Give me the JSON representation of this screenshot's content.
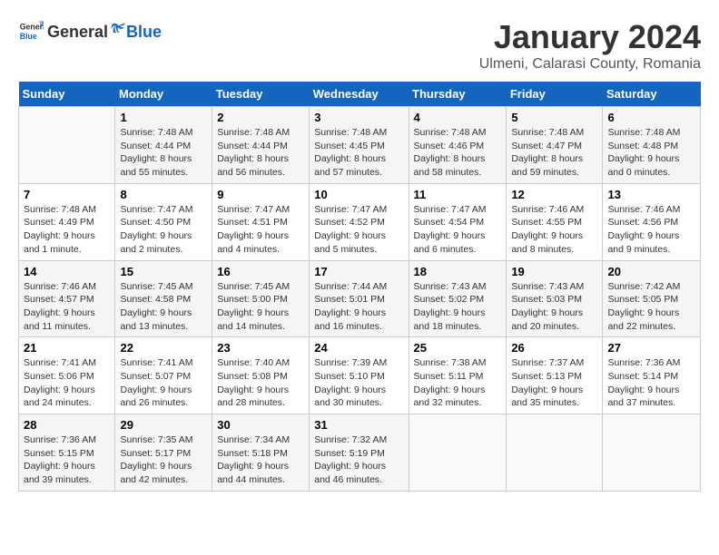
{
  "header": {
    "logo_general": "General",
    "logo_blue": "Blue",
    "title": "January 2024",
    "subtitle": "Ulmeni, Calarasi County, Romania"
  },
  "days_of_week": [
    "Sunday",
    "Monday",
    "Tuesday",
    "Wednesday",
    "Thursday",
    "Friday",
    "Saturday"
  ],
  "weeks": [
    [
      {
        "day": "",
        "info": ""
      },
      {
        "day": "1",
        "info": "Sunrise: 7:48 AM\nSunset: 4:44 PM\nDaylight: 8 hours\nand 55 minutes."
      },
      {
        "day": "2",
        "info": "Sunrise: 7:48 AM\nSunset: 4:44 PM\nDaylight: 8 hours\nand 56 minutes."
      },
      {
        "day": "3",
        "info": "Sunrise: 7:48 AM\nSunset: 4:45 PM\nDaylight: 8 hours\nand 57 minutes."
      },
      {
        "day": "4",
        "info": "Sunrise: 7:48 AM\nSunset: 4:46 PM\nDaylight: 8 hours\nand 58 minutes."
      },
      {
        "day": "5",
        "info": "Sunrise: 7:48 AM\nSunset: 4:47 PM\nDaylight: 8 hours\nand 59 minutes."
      },
      {
        "day": "6",
        "info": "Sunrise: 7:48 AM\nSunset: 4:48 PM\nDaylight: 9 hours\nand 0 minutes."
      }
    ],
    [
      {
        "day": "7",
        "info": "Sunrise: 7:48 AM\nSunset: 4:49 PM\nDaylight: 9 hours\nand 1 minute."
      },
      {
        "day": "8",
        "info": "Sunrise: 7:47 AM\nSunset: 4:50 PM\nDaylight: 9 hours\nand 2 minutes."
      },
      {
        "day": "9",
        "info": "Sunrise: 7:47 AM\nSunset: 4:51 PM\nDaylight: 9 hours\nand 4 minutes."
      },
      {
        "day": "10",
        "info": "Sunrise: 7:47 AM\nSunset: 4:52 PM\nDaylight: 9 hours\nand 5 minutes."
      },
      {
        "day": "11",
        "info": "Sunrise: 7:47 AM\nSunset: 4:54 PM\nDaylight: 9 hours\nand 6 minutes."
      },
      {
        "day": "12",
        "info": "Sunrise: 7:46 AM\nSunset: 4:55 PM\nDaylight: 9 hours\nand 8 minutes."
      },
      {
        "day": "13",
        "info": "Sunrise: 7:46 AM\nSunset: 4:56 PM\nDaylight: 9 hours\nand 9 minutes."
      }
    ],
    [
      {
        "day": "14",
        "info": "Sunrise: 7:46 AM\nSunset: 4:57 PM\nDaylight: 9 hours\nand 11 minutes."
      },
      {
        "day": "15",
        "info": "Sunrise: 7:45 AM\nSunset: 4:58 PM\nDaylight: 9 hours\nand 13 minutes."
      },
      {
        "day": "16",
        "info": "Sunrise: 7:45 AM\nSunset: 5:00 PM\nDaylight: 9 hours\nand 14 minutes."
      },
      {
        "day": "17",
        "info": "Sunrise: 7:44 AM\nSunset: 5:01 PM\nDaylight: 9 hours\nand 16 minutes."
      },
      {
        "day": "18",
        "info": "Sunrise: 7:43 AM\nSunset: 5:02 PM\nDaylight: 9 hours\nand 18 minutes."
      },
      {
        "day": "19",
        "info": "Sunrise: 7:43 AM\nSunset: 5:03 PM\nDaylight: 9 hours\nand 20 minutes."
      },
      {
        "day": "20",
        "info": "Sunrise: 7:42 AM\nSunset: 5:05 PM\nDaylight: 9 hours\nand 22 minutes."
      }
    ],
    [
      {
        "day": "21",
        "info": "Sunrise: 7:41 AM\nSunset: 5:06 PM\nDaylight: 9 hours\nand 24 minutes."
      },
      {
        "day": "22",
        "info": "Sunrise: 7:41 AM\nSunset: 5:07 PM\nDaylight: 9 hours\nand 26 minutes."
      },
      {
        "day": "23",
        "info": "Sunrise: 7:40 AM\nSunset: 5:08 PM\nDaylight: 9 hours\nand 28 minutes."
      },
      {
        "day": "24",
        "info": "Sunrise: 7:39 AM\nSunset: 5:10 PM\nDaylight: 9 hours\nand 30 minutes."
      },
      {
        "day": "25",
        "info": "Sunrise: 7:38 AM\nSunset: 5:11 PM\nDaylight: 9 hours\nand 32 minutes."
      },
      {
        "day": "26",
        "info": "Sunrise: 7:37 AM\nSunset: 5:13 PM\nDaylight: 9 hours\nand 35 minutes."
      },
      {
        "day": "27",
        "info": "Sunrise: 7:36 AM\nSunset: 5:14 PM\nDaylight: 9 hours\nand 37 minutes."
      }
    ],
    [
      {
        "day": "28",
        "info": "Sunrise: 7:36 AM\nSunset: 5:15 PM\nDaylight: 9 hours\nand 39 minutes."
      },
      {
        "day": "29",
        "info": "Sunrise: 7:35 AM\nSunset: 5:17 PM\nDaylight: 9 hours\nand 42 minutes."
      },
      {
        "day": "30",
        "info": "Sunrise: 7:34 AM\nSunset: 5:18 PM\nDaylight: 9 hours\nand 44 minutes."
      },
      {
        "day": "31",
        "info": "Sunrise: 7:32 AM\nSunset: 5:19 PM\nDaylight: 9 hours\nand 46 minutes."
      },
      {
        "day": "",
        "info": ""
      },
      {
        "day": "",
        "info": ""
      },
      {
        "day": "",
        "info": ""
      }
    ]
  ]
}
